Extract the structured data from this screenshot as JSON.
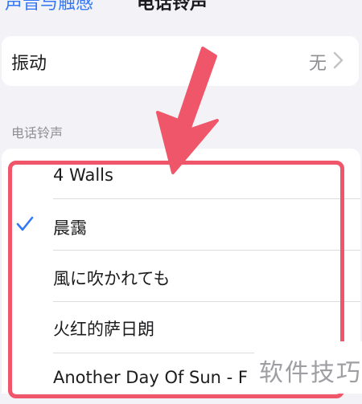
{
  "nav": {
    "back_label": "声音与触感",
    "title": "电话铃声"
  },
  "vibration": {
    "label": "振动",
    "value": "无",
    "chevron_icon": "chevron-right-icon"
  },
  "ringtones": {
    "section_header": "电话铃声",
    "selected_icon": "checkmark-icon",
    "items": [
      {
        "label": "4 Walls",
        "selected": false
      },
      {
        "label": "晨靄",
        "selected": true
      },
      {
        "label": "風に吹かれても",
        "selected": false
      },
      {
        "label": "火红的萨日朗",
        "selected": false
      },
      {
        "label": "Another Day Of Sun - F",
        "selected": false
      }
    ]
  },
  "annotation": {
    "arrow_icon": "arrow-down-icon",
    "color": "#f0566a"
  },
  "watermark": {
    "text": "软件技巧"
  },
  "colors": {
    "accent": "#3478f6",
    "background": "#f2f2f7",
    "secondary_text": "#8e8e93"
  }
}
